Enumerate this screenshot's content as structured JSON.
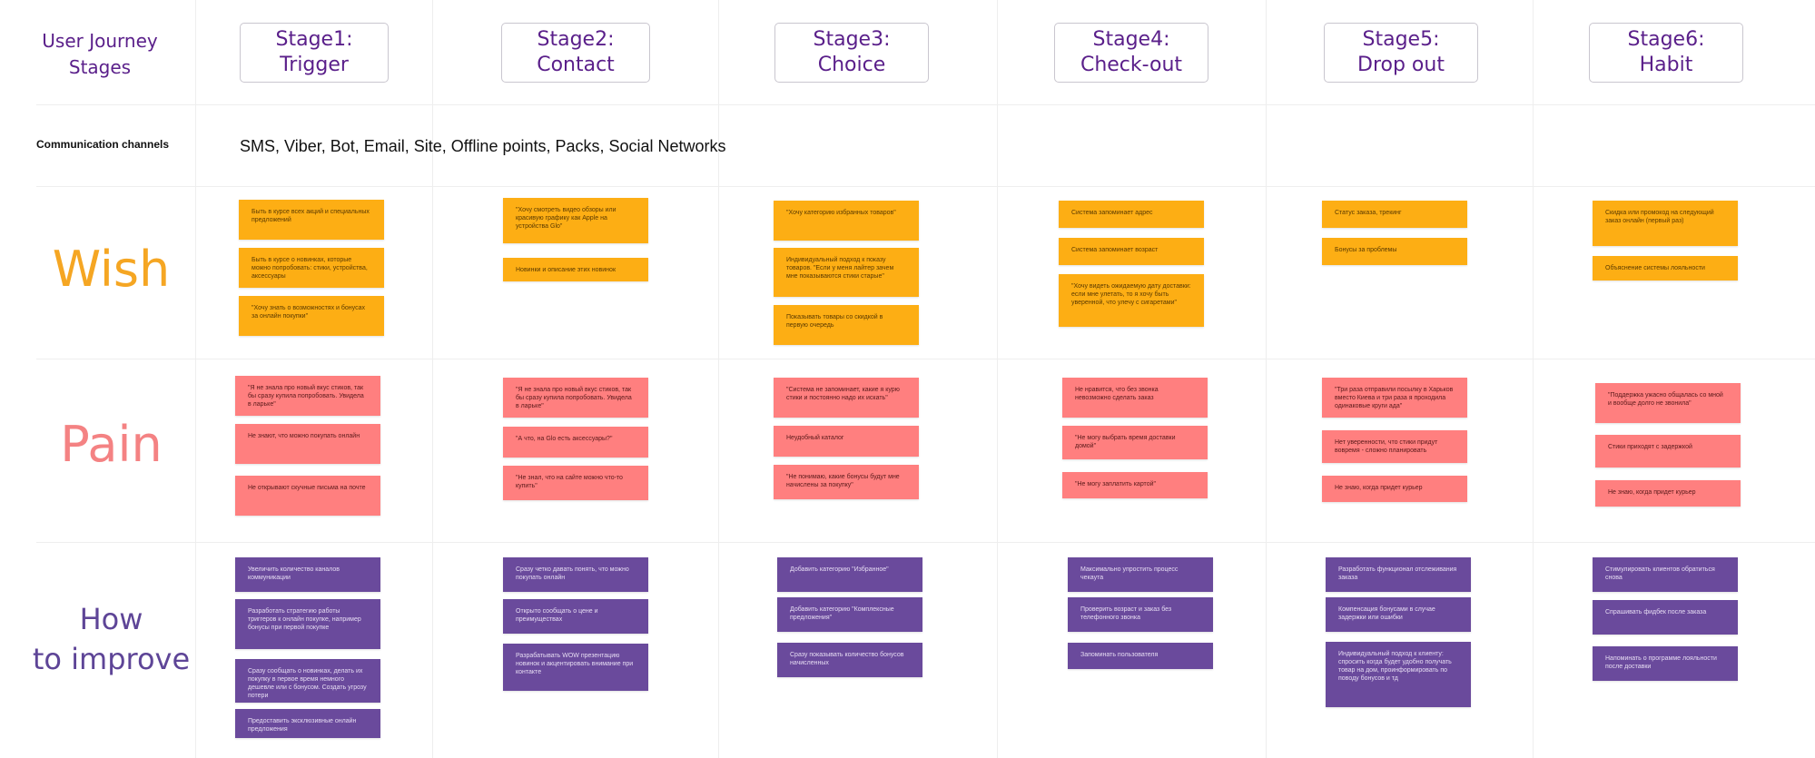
{
  "header": {
    "title_line1": "User Journey",
    "title_line2": "Stages"
  },
  "stages": [
    {
      "line1": "Stage1:",
      "line2": "Trigger"
    },
    {
      "line1": "Stage2:",
      "line2": "Contact"
    },
    {
      "line1": "Stage3:",
      "line2": "Choice"
    },
    {
      "line1": "Stage4:",
      "line2": "Check-out"
    },
    {
      "line1": "Stage5:",
      "line2": "Drop out"
    },
    {
      "line1": "Stage6:",
      "line2": "Habit"
    }
  ],
  "channels": {
    "label": "Communication channels",
    "text": "SMS, Viber, Bot, Email, Site, Offline points, Packs, Social Networks"
  },
  "rows": {
    "wish": {
      "label": "Wish",
      "color": "#F5A623",
      "note_color": "#FDAE14"
    },
    "pain": {
      "label": "Pain",
      "color": "#F48283",
      "note_color": "#FF7F7F"
    },
    "improve": {
      "label_line1": "How",
      "label_line2": "to improve",
      "color": "#5E4597",
      "note_color": "#6A4A9C"
    }
  },
  "notes": {
    "wish": [
      [
        "Быть в курсе всех акций и специальных предложений",
        "Быть в курсе о новинках, которые можно попробовать: стики, устройства, аксессуары",
        "\"Хочу знать о возможностях и бонусах за онлайн покупки\""
      ],
      [
        "\"Хочу смотреть видео обзоры или красивую графику как Apple на устройства Glo\"",
        "Новинки и описание этих новинок"
      ],
      [
        "\"Хочу категорию избранных товаров\"",
        "Индивидуальный подход к показу товаров. \"Если у меня лайтер зачем мне показываются стики старые\"",
        "Показывать товары со скидкой в первую очередь"
      ],
      [
        "Система запоминает адрес",
        "Система запоминает возраст",
        "\"Хочу видеть ожидаемую дату доставки: если мне улетать, то я хочу быть уверенной, что улечу с сигаретами\""
      ],
      [
        "Статус заказа, трекинг",
        "Бонусы за проблемы"
      ],
      [
        "Скидка или промокод на следующий заказ онлайн (первый раз)",
        "Объяснение системы лояльности"
      ]
    ],
    "pain": [
      [
        "\"Я не знала про новый вкус стиков, так бы сразу купила попробовать. Увидела в ларьке\"",
        "Не знают, что можно покупать онлайн",
        "Не открывают скучные письма на почте"
      ],
      [
        "\"Я не знала про новый вкус стиков, так бы сразу купила попробовать. Увидела в ларьке\"",
        "\"А что, на Glo есть аксессуары?\"",
        "\"Не знал, что на сайте можно что-то купить\""
      ],
      [
        "\"Система не запоминает, какие я курю стики и постоянно надо их искать\"",
        "Неудобный каталог",
        "\"Не понимаю, какие бонусы будут мне начислены за покупку\""
      ],
      [
        "Не нравится, что без звонка невозможно сделать заказ",
        "\"Не могу выбрать время доставки домой\"",
        "\"Не могу заплатить картой\""
      ],
      [
        "\"Три раза отправили посылку в Харьков вместо Киева и три раза я проходила одинаковые круги ада\"",
        "Нет уверенности, что стики придут вовремя - сложно планировать",
        "Не знаю, когда придет курьер"
      ],
      [
        "\"Поддержка ужасно общалась со мной и вообще долго не звонила\"",
        "Стики приходят с задержкой",
        "Не знаю, когда придет курьер"
      ]
    ],
    "improve": [
      [
        "Увеличить количество каналов коммуникации",
        "Разработать стратегию работы триггеров к онлайн покупке, например бонусы при первой покупке",
        "Сразу сообщать о новинках, делать их покупку в первое время немного дешевле или с бонусом. Создать угрозу потери",
        "Предоставить эксклюзивные онлайн предложения"
      ],
      [
        "Сразу четко давать понять, что можно покупать онлайн",
        "Открыто сообщать о цене и преимуществах",
        "Разрабатывать WOW презентацию новинок и акцентировать внимание при контакте"
      ],
      [
        "Добавить категорию \"Избранное\"",
        "Добавить категорию \"Комплексные предложения\"",
        "Сразу показывать количество бонусов начисленных"
      ],
      [
        "Максимально упростить процесс чекаута",
        "Проверить возраст и заказ без телефонного звонка",
        "Запоминать пользователя"
      ],
      [
        "Разработать функционал отслеживания заказа",
        "Компенсация бонусами в случае задержки или ошибки",
        "Индивидуальный подход к клиенту: спросить когда будет удобно получать товар на дом, проинформировать по поводу бонусов и тд"
      ],
      [
        "Стимулировать клиентов обратиться снова",
        "Спрашивать фидбек после заказа",
        "Напоминать о программе лояльности после доставки"
      ]
    ]
  }
}
